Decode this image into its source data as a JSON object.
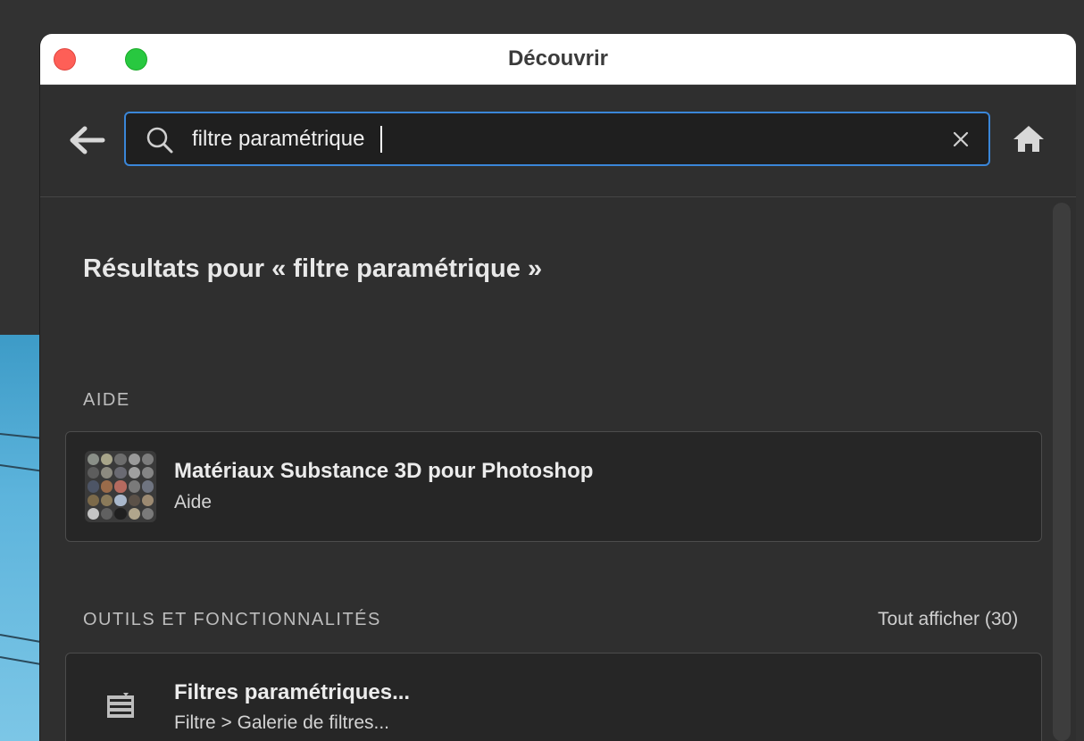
{
  "window": {
    "title": "Découvrir"
  },
  "search": {
    "value": "filtre paramétrique",
    "placeholder": ""
  },
  "results": {
    "title": "Résultats pour « filtre paramétrique »"
  },
  "help_section": {
    "label": "AIDE",
    "items": [
      {
        "title": "Matériaux Substance 3D pour Photoshop",
        "subtitle": "Aide",
        "icon": "materials-thumbnail"
      }
    ]
  },
  "tools_section": {
    "label": "OUTILS ET FONCTIONNALITÉS",
    "show_all": "Tout afficher (30)",
    "items": [
      {
        "title": "Filtres paramétriques...",
        "subtitle": "Filtre > Galerie de filtres...",
        "icon": "filter-gallery-icon"
      }
    ]
  },
  "colors": {
    "accent": "#3a86d8",
    "close": "#fe5f57",
    "zoom": "#28c840"
  }
}
